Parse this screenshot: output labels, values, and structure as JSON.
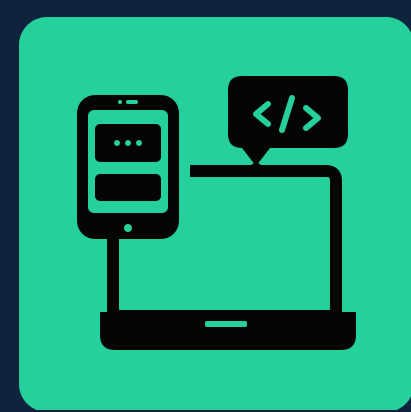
{
  "colors": {
    "page_background": "#10233d",
    "tile_background": "#25d09c",
    "icon_ink": "#050505"
  },
  "icons": {
    "main": "app-development-icon",
    "code_bubble": "code-tag-bubble-icon",
    "phone": "smartphone-icon",
    "laptop": "laptop-icon"
  },
  "code_bubble": {
    "glyph": "</>"
  }
}
